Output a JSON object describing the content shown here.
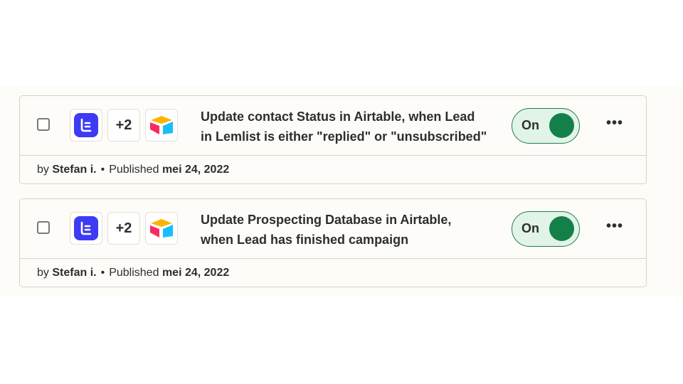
{
  "zaps": [
    {
      "apps": [
        "lemlist-icon",
        "more-apps",
        "airtable-icon"
      ],
      "extra_apps": "+2",
      "title_line1": "Update contact Status in Airtable, when Lead",
      "title_line2": "in Lemlist is either \"replied\" or \"unsubscribed\"",
      "toggle_label": "On",
      "toggle_state": "on",
      "by": "by",
      "author": "Stefan i.",
      "published_label": "Published",
      "date": "mei 24, 2022",
      "menu_label": "•••"
    },
    {
      "apps": [
        "lemlist-icon",
        "more-apps",
        "airtable-icon"
      ],
      "extra_apps": "+2",
      "title_line1": "Update Prospecting Database in Airtable,",
      "title_line2": "when Lead has finished campaign",
      "toggle_label": "On",
      "toggle_state": "on",
      "by": "by",
      "author": "Stefan i.",
      "published_label": "Published",
      "date": "mei 24, 2022",
      "menu_label": "•••"
    }
  ],
  "colors": {
    "lemlist": "#3d3bf3",
    "toggle_on": "#13804a",
    "toggle_bg": "#e2f3e8"
  }
}
